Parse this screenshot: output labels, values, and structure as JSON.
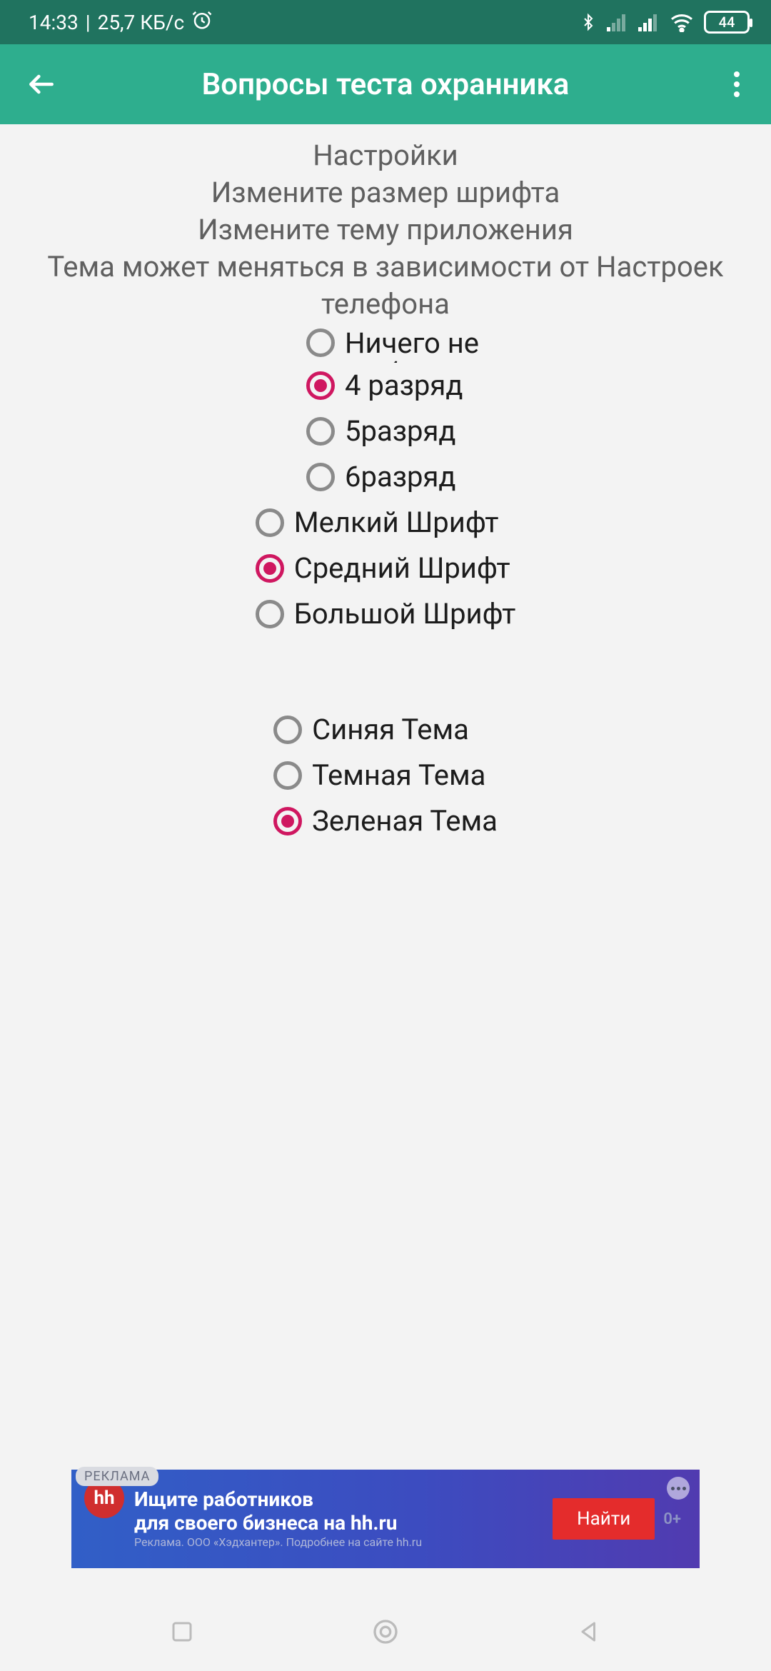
{
  "status": {
    "time": "14:33",
    "speed": "25,7 КБ/с",
    "battery": "44"
  },
  "appbar": {
    "title": "Вопросы теста охранника"
  },
  "headers": {
    "l1": "Настройки",
    "l2": "Измените размер шрифта",
    "l3": "Измените тему приложения",
    "l4": "Тема может меняться в зависимости от Настроек телефона"
  },
  "rank": {
    "opt0": {
      "label": "Ничего не выбрано",
      "selected": false
    },
    "opt1": {
      "label": "4 разряд",
      "selected": true
    },
    "opt2": {
      "label": "5разряд",
      "selected": false
    },
    "opt3": {
      "label": "6разряд",
      "selected": false
    }
  },
  "font": {
    "opt0": {
      "label": "Мелкий Шрифт",
      "selected": false
    },
    "opt1": {
      "label": "Средний Шрифт",
      "selected": true
    },
    "opt2": {
      "label": "Большой Шрифт",
      "selected": false
    }
  },
  "theme": {
    "opt0": {
      "label": "Синяя Тема",
      "selected": false
    },
    "opt1": {
      "label": "Темная Тема",
      "selected": false
    },
    "opt2": {
      "label": "Зеленая Тема",
      "selected": true
    }
  },
  "ad": {
    "tag": "РЕКЛАМА",
    "logo": "hh",
    "line1a": "Ищите работников",
    "line1b": "для своего бизнеса на hh.ru",
    "line2": "Реклама. ООО «Хэдхантер». Подробнее на сайте hh.ru",
    "cta": "Найти",
    "badge": "0+"
  }
}
